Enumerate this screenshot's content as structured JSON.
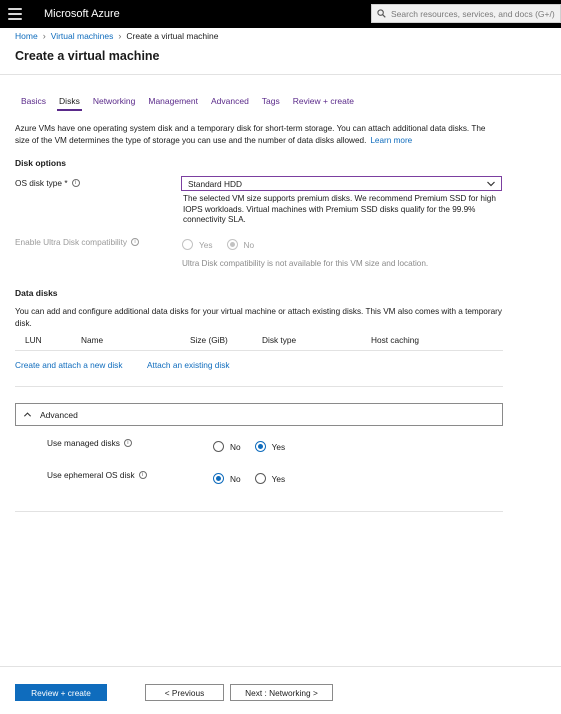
{
  "topbar": {
    "brand": "Microsoft Azure",
    "search_placeholder": "Search resources, services, and docs (G+/)"
  },
  "breadcrumb": {
    "items": [
      "Home",
      "Virtual machines",
      "Create a virtual machine"
    ]
  },
  "page": {
    "title": "Create a virtual machine"
  },
  "tabs": [
    {
      "label": "Basics",
      "active": false
    },
    {
      "label": "Disks",
      "active": true
    },
    {
      "label": "Networking",
      "active": false
    },
    {
      "label": "Management",
      "active": false
    },
    {
      "label": "Advanced",
      "active": false
    },
    {
      "label": "Tags",
      "active": false
    },
    {
      "label": "Review + create",
      "active": false
    }
  ],
  "intro": {
    "text": "Azure VMs have one operating system disk and a temporary disk for short-term storage. You can attach additional data disks. The size of the VM determines the type of storage you can use and the number of data disks allowed.",
    "learn_more": "Learn more"
  },
  "disk_options": {
    "title": "Disk options",
    "os_disk_type_label": "OS disk type *",
    "os_disk_type_value": "Standard HDD",
    "os_disk_help": "The selected VM size supports premium disks. We recommend Premium SSD for high IOPS workloads. Virtual machines with Premium SSD disks qualify for the 99.9% connectivity SLA.",
    "ultra_label": "Enable Ultra Disk compatibility",
    "ultra_yes": "Yes",
    "ultra_no": "No",
    "ultra_selected": "No",
    "ultra_note": "Ultra Disk compatibility is not available for this VM size and location."
  },
  "data_disks": {
    "title": "Data disks",
    "description": "You can add and configure additional data disks for your virtual machine or attach existing disks. This VM also comes with a temporary disk.",
    "columns": [
      "LUN",
      "Name",
      "Size (GiB)",
      "Disk type",
      "Host caching"
    ],
    "create_link": "Create and attach a new disk",
    "attach_link": "Attach an existing disk"
  },
  "advanced": {
    "title": "Advanced",
    "expanded": true,
    "managed_label": "Use managed disks",
    "managed_no": "No",
    "managed_yes": "Yes",
    "managed_selected": "Yes",
    "ephemeral_label": "Use ephemeral OS disk",
    "ephemeral_no": "No",
    "ephemeral_yes": "Yes",
    "ephemeral_selected": "No"
  },
  "footer": {
    "review_create": "Review + create",
    "previous": "< Previous",
    "next": "Next : Networking >"
  },
  "colors": {
    "accent": "#0f6cbd",
    "tab_accent": "#5a2a8a",
    "topbar": "#000000"
  }
}
